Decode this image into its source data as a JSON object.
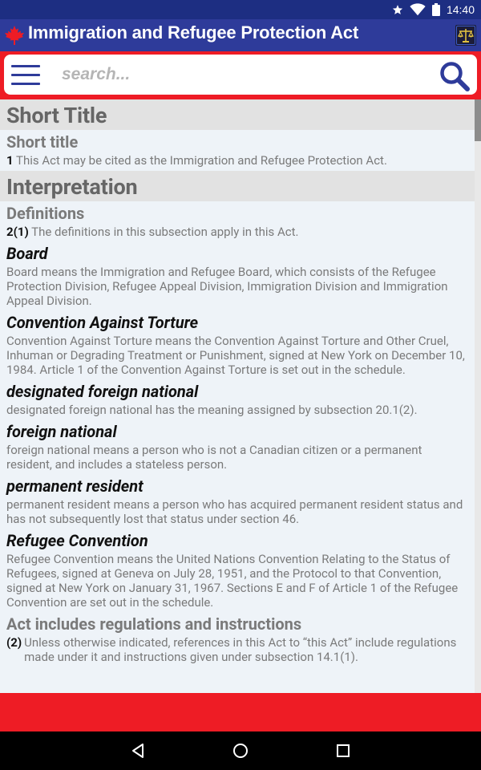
{
  "status": {
    "time": "14:40"
  },
  "app": {
    "title": "Immigration and Refugee Protection Act"
  },
  "search": {
    "placeholder": "search..."
  },
  "content": {
    "parts": [
      {
        "heading": "Short Title",
        "sections": [
          {
            "heading": "Short title",
            "paragraphs": [
              {
                "num": "1",
                "text": "This Act may be cited as the Immigration and Refugee Protection Act."
              }
            ]
          }
        ]
      },
      {
        "heading": "Interpretation",
        "sections": [
          {
            "heading": "Definitions",
            "intro": {
              "num": "2(1)",
              "text": "The definitions in this subsection apply in this Act."
            },
            "definitions": [
              {
                "term": "Board",
                "text": "Board means the Immigration and Refugee Board, which consists of the Refugee Protection Division, Refugee Appeal Division, Immigration Division and Immigration Appeal Division."
              },
              {
                "term": "Convention Against Torture",
                "text": "Convention Against Torture means the Convention Against Torture and Other Cruel, Inhuman or Degrading Treatment or Punishment, signed at New York on December 10, 1984. Article 1 of the Convention Against Torture is set out in the schedule."
              },
              {
                "term": "designated foreign national",
                "text": "designated foreign national has the meaning assigned by subsection 20.1(2)."
              },
              {
                "term": "foreign national",
                "text": "foreign national means a person who is not a Canadian citizen or a permanent resident, and includes a stateless person."
              },
              {
                "term": "permanent resident",
                "text": "permanent resident means a person who has acquired permanent resident status and has not subsequently lost that status under section 46."
              },
              {
                "term": "Refugee Convention",
                "text": "Refugee Convention means the United Nations Convention Relating to the Status of Refugees, signed at Geneva on July 28, 1951, and the Protocol to that Convention, signed at New York on January 31, 1967. Sections E and F of Article 1 of the Refugee Convention are set out in the schedule."
              }
            ]
          },
          {
            "heading": "Act includes regulations and instructions",
            "paragraphs": [
              {
                "num": "(2)",
                "text": "Unless otherwise indicated, references in this Act to “this Act” include regulations made under it and instructions given under subsection 14.1(1)."
              }
            ]
          }
        ]
      }
    ]
  },
  "colors": {
    "status_bar": "#1d2e82",
    "app_bar": "#2e3b9a",
    "accent_red": "#ee1c25",
    "content_bg": "#eef3f8",
    "heading_band": "#e2e2e2"
  },
  "icons": {
    "app_logo": "maple-leaf-icon",
    "app_action": "scales-icon",
    "menu": "menu-icon",
    "search": "search-icon",
    "nav_back": "back-icon",
    "nav_home": "home-icon",
    "nav_recents": "recents-icon"
  }
}
